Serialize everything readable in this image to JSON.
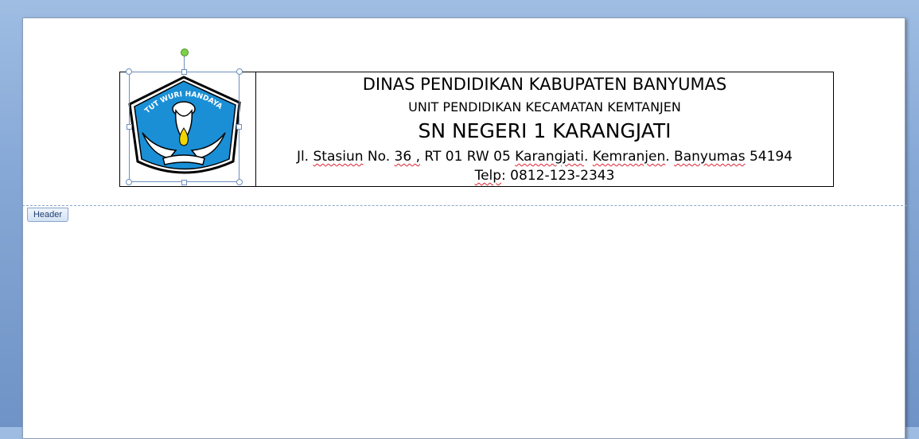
{
  "letterhead": {
    "line1": "DINAS PENDIDIKAN KABUPATEN BANYUMAS",
    "line2": "UNIT PENDIDIKAN  KECAMATAN KEMTANJEN",
    "line3": "SN NEGERI 1 KARANGJATI",
    "address": {
      "p1": "Jl. ",
      "w_stasiun": "Stasiun",
      "p2": " No. ",
      "w_36": "36 ,",
      "p3": " RT 01 RW 05 ",
      "w_karangjati": "Karangjati",
      "p4": ". ",
      "w_kemranjen": "Kemranjen",
      "p5": ". ",
      "w_banyumas": "Banyumas",
      "p6": " 54194"
    },
    "phone": {
      "w_telp": "Telp",
      "rest": ": 0812-123-2343"
    }
  },
  "logo": {
    "motto": "TUT WURI HANDAYANI",
    "colors": {
      "shield": "#1a8fd6",
      "outline": "#000000",
      "flame": "#f2d500"
    }
  },
  "header_tab": {
    "label": "Header"
  },
  "colors": {
    "accent": "#7dd04a",
    "selection": "#6b8fbf"
  }
}
